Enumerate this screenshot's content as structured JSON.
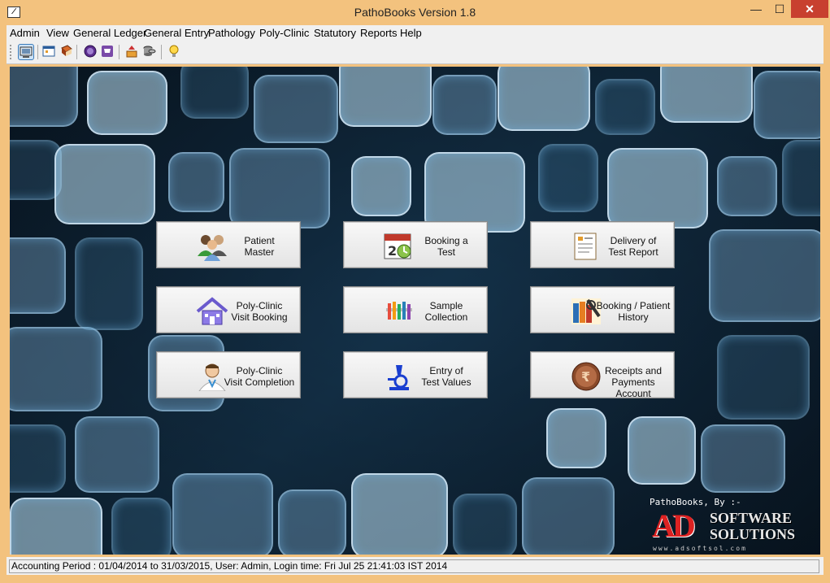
{
  "window": {
    "title": "PathoBooks Version 1.8",
    "app_icon_glyph": "∕",
    "min_glyph": "—",
    "max_glyph": "☐",
    "close_glyph": "✕"
  },
  "menu": [
    "Admin",
    "View",
    "General Ledger",
    "General Entry",
    "Pathology",
    "Poly-Clinic",
    "Statutory",
    "Reports",
    "Help"
  ],
  "toolbar": {
    "icons": [
      "monitor-icon",
      "calendar-icon",
      "book-icon",
      "stamp-icon",
      "cart-icon",
      "export-icon",
      "database-icon",
      "bulb-icon"
    ]
  },
  "buttons": [
    {
      "label": "Patient\nMaster",
      "icon": "patients-icon"
    },
    {
      "label": "Booking a\nTest",
      "icon": "calendar-clock-icon"
    },
    {
      "label": "Delivery of\nTest Report",
      "icon": "report-icon"
    },
    {
      "label": "Poly-Clinic\nVisit Booking",
      "icon": "house-icon"
    },
    {
      "label": "Sample\nCollection",
      "icon": "test-tubes-icon"
    },
    {
      "label": "Booking / Patient\nHistory",
      "icon": "history-books-icon"
    },
    {
      "label": "Poly-Clinic\nVisit Completion",
      "icon": "doctor-icon"
    },
    {
      "label": "Entry of\nTest Values",
      "icon": "microscope-icon"
    },
    {
      "label": "Receipts and\nPayments Account",
      "icon": "coin-icon"
    }
  ],
  "brand": {
    "by_text": "PathoBooks, By :-",
    "logo_ad": "AD",
    "logo_words": "SOFTWARE\nSOLUTIONS",
    "url_text": "www.adsoftsol.com"
  },
  "status": {
    "text": "Accounting Period : 01/04/2014 to 31/03/2015, User: Admin, Login time: Fri Jul 25 21:41:03 IST 2014"
  }
}
